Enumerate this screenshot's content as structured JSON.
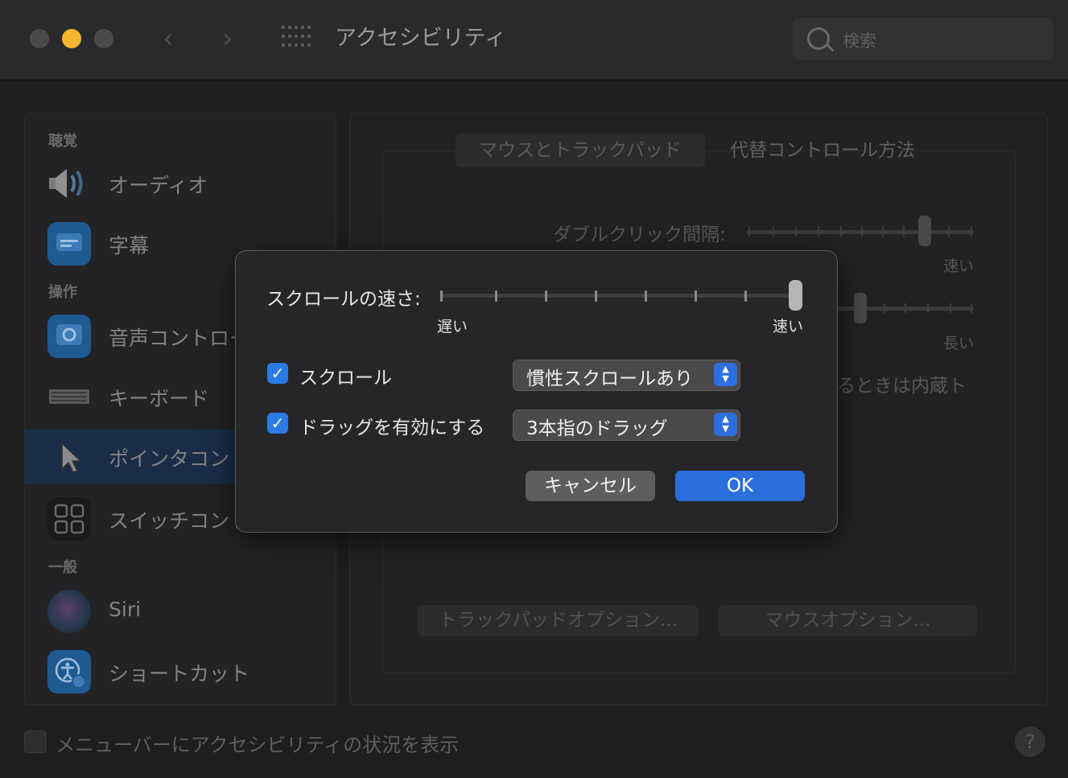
{
  "window": {
    "title": "アクセシビリティ",
    "search_placeholder": "検索"
  },
  "sidebar": {
    "sections": [
      {
        "label": "聴覚"
      },
      {
        "label": "操作"
      },
      {
        "label": "一般"
      }
    ],
    "items": [
      {
        "label": "オーディオ",
        "icon": "speaker-icon"
      },
      {
        "label": "字幕",
        "icon": "captions-icon"
      },
      {
        "label": "音声コントロール",
        "icon": "voice-control-icon"
      },
      {
        "label": "キーボード",
        "icon": "keyboard-icon"
      },
      {
        "label": "ポインタコントロール",
        "icon": "pointer-icon",
        "selected": true
      },
      {
        "label": "スイッチコントロール",
        "icon": "switch-grid-icon"
      },
      {
        "label": "Siri",
        "icon": "siri-icon"
      },
      {
        "label": "ショートカット",
        "icon": "accessibility-shortcut-icon"
      }
    ]
  },
  "panel": {
    "tabs": [
      {
        "label": "マウスとトラックパッド",
        "selected": true
      },
      {
        "label": "代替コントロール方法"
      }
    ],
    "double_click_label": "ダブルクリック間隔:",
    "fast_label": "速い",
    "long_label": "長い",
    "partial_text": "るときは内蔵ト",
    "trackpad_options": "トラックパッドオプション...",
    "mouse_options": "マウスオプション..."
  },
  "bottom": {
    "show_status_label": "メニューバーにアクセシビリティの状況を表示",
    "help": "?"
  },
  "sheet": {
    "scroll_speed_label": "スクロールの速さ:",
    "slow": "遅い",
    "fast": "速い",
    "scroll_speed_value": 1.0,
    "scroll_checkbox": {
      "label": "スクロール",
      "checked": true
    },
    "scroll_popup": "慣性スクロールあり",
    "drag_checkbox": {
      "label": "ドラッグを有効にする",
      "checked": true
    },
    "drag_popup": "3本指のドラッグ",
    "cancel": "キャンセル",
    "ok": "OK"
  },
  "colors": {
    "accent": "#2b6fdc",
    "minimize": "#f5b82e"
  }
}
